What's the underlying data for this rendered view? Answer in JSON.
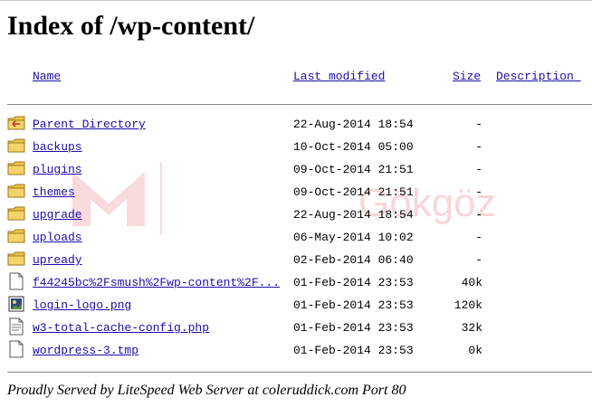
{
  "page": {
    "title": "Index of /wp-content/"
  },
  "columns": {
    "name": "Name",
    "last_modified": "Last modified",
    "size": "Size",
    "description": "Description"
  },
  "rows": [
    {
      "icon": "back-folder-icon",
      "name": "Parent Directory",
      "date": "22-Aug-2014 18:54",
      "size": "-"
    },
    {
      "icon": "folder-icon",
      "name": "backups",
      "date": "10-Oct-2014 05:00",
      "size": "-"
    },
    {
      "icon": "folder-icon",
      "name": "plugins",
      "date": "09-Oct-2014 21:51",
      "size": "-"
    },
    {
      "icon": "folder-icon",
      "name": "themes",
      "date": "09-Oct-2014 21:51",
      "size": "-"
    },
    {
      "icon": "folder-icon",
      "name": "upgrade",
      "date": "22-Aug-2014 18:54",
      "size": "-"
    },
    {
      "icon": "folder-icon",
      "name": "uploads",
      "date": "06-May-2014 10:02",
      "size": "-"
    },
    {
      "icon": "folder-icon",
      "name": "upready",
      "date": "02-Feb-2014 06:40",
      "size": "-"
    },
    {
      "icon": "file-icon",
      "name": "f44245bc%2Fsmush%2Fwp-content%2F...",
      "date": "01-Feb-2014 23:53",
      "size": "40k"
    },
    {
      "icon": "image-file-icon",
      "name": "login-logo.png",
      "date": "01-Feb-2014 23:53",
      "size": "120k"
    },
    {
      "icon": "text-file-icon",
      "name": "w3-total-cache-config.php",
      "date": "01-Feb-2014 23:53",
      "size": "32k"
    },
    {
      "icon": "file-icon",
      "name": "wordpress-3.tmp",
      "date": "01-Feb-2014 23:53",
      "size": "0k"
    }
  ],
  "footer": "Proudly Served by LiteSpeed Web Server at coleruddick.com Port 80",
  "watermark": "Gökgöz",
  "colors": {
    "link": "#1a0dab",
    "folder": "#f0c24a"
  }
}
